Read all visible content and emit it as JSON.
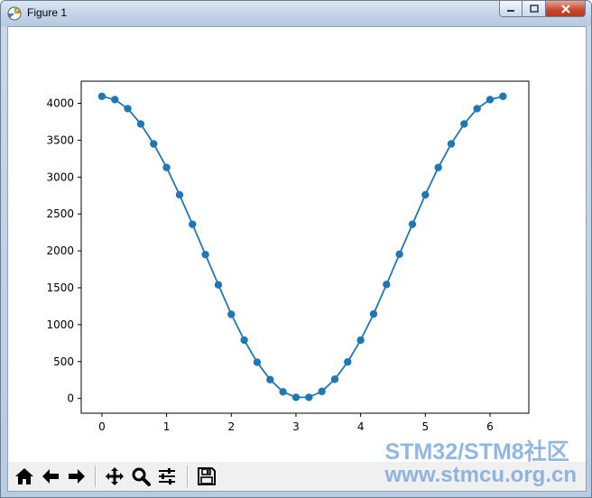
{
  "window": {
    "title": "Figure 1",
    "minimize_icon": "minimize-icon",
    "maximize_icon": "maximize-icon",
    "close_icon": "close-icon"
  },
  "colors": {
    "series": "#1f77b4",
    "axes": "#000000",
    "toolbar_bg": "#f0f0f0",
    "watermark": "#6ea0d7"
  },
  "toolbar": {
    "buttons": [
      {
        "name": "home-icon"
      },
      {
        "name": "back-arrow-icon"
      },
      {
        "name": "forward-arrow-icon"
      },
      {
        "name": "pan-icon"
      },
      {
        "name": "zoom-icon"
      },
      {
        "name": "subplots-config-icon"
      },
      {
        "name": "save-icon"
      }
    ]
  },
  "watermark": {
    "line1": "STM32/STM8社区",
    "line2": "www.stmcu.org.cn"
  },
  "chart_data": {
    "type": "line",
    "marker": "circle",
    "title": "",
    "xlabel": "",
    "ylabel": "",
    "xlim": [
      -0.32,
      6.6
    ],
    "ylim": [
      -200,
      4300
    ],
    "xticks": [
      "0",
      "1",
      "2",
      "3",
      "4",
      "5",
      "6"
    ],
    "yticks": [
      "0",
      "500",
      "1000",
      "1500",
      "2000",
      "2500",
      "3000",
      "3500",
      "4000"
    ],
    "grid": false,
    "legend": "none",
    "series": [
      {
        "x": [
          0,
          0.2,
          0.4,
          0.6,
          0.8,
          1.0,
          1.2,
          1.4,
          1.6,
          1.8,
          2.0,
          2.2,
          2.4,
          2.6,
          2.8,
          3.0,
          3.2,
          3.4,
          3.6,
          3.8,
          4.0,
          4.2,
          4.4,
          4.6,
          4.8,
          5.0,
          5.2,
          5.4,
          5.6,
          5.8,
          6.0,
          6.2
        ],
        "values": [
          4095,
          4050,
          3928,
          3720,
          3450,
          3130,
          2760,
          2360,
          1950,
          1540,
          1140,
          790,
          490,
          255,
          90,
          15,
          15,
          95,
          260,
          495,
          790,
          1145,
          1545,
          1955,
          2360,
          2760,
          3130,
          3450,
          3720,
          3928,
          4050,
          4095
        ]
      }
    ]
  }
}
